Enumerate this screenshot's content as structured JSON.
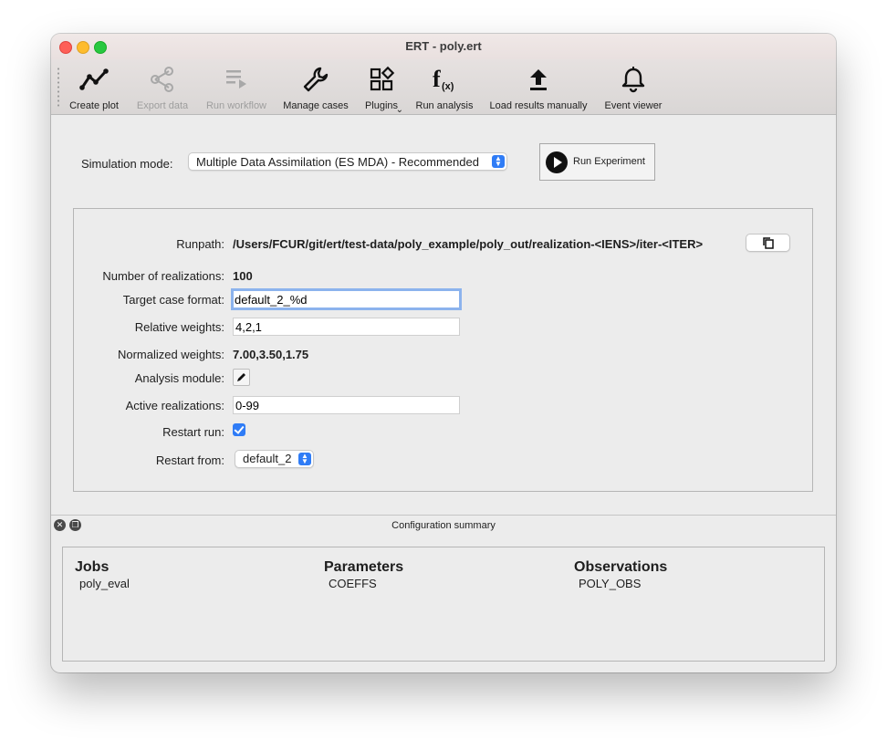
{
  "window": {
    "title": "ERT - poly.ert"
  },
  "toolbar": {
    "create_plot": "Create plot",
    "export_data": "Export data",
    "run_workflow": "Run workflow",
    "manage_cases": "Manage cases",
    "plugins": "Plugins",
    "run_analysis": "Run analysis",
    "load_results": "Load results manually",
    "event_viewer": "Event viewer"
  },
  "simulation": {
    "mode_label": "Simulation mode:",
    "mode_value": "Multiple Data Assimilation (ES MDA) - Recommended",
    "run_button": "Run Experiment"
  },
  "config": {
    "runpath_label": "Runpath:",
    "runpath_value": "/Users/FCUR/git/ert/test-data/poly_example/poly_out/realization-<IENS>/iter-<ITER>",
    "num_realizations_label": "Number of realizations:",
    "num_realizations_value": "100",
    "target_case_label": "Target case format:",
    "target_case_value": "default_2_%d",
    "relative_weights_label": "Relative weights:",
    "relative_weights_value": "4,2,1",
    "normalized_weights_label": "Normalized weights:",
    "normalized_weights_value": "7.00,3.50,1.75",
    "analysis_module_label": "Analysis module:",
    "active_realizations_label": "Active realizations:",
    "active_realizations_value": "0-99",
    "restart_run_label": "Restart run:",
    "restart_run_checked": true,
    "restart_from_label": "Restart from:",
    "restart_from_value": "default_2"
  },
  "summary": {
    "title": "Configuration summary",
    "jobs_header": "Jobs",
    "jobs": [
      "poly_eval"
    ],
    "parameters_header": "Parameters",
    "parameters": [
      "COEFFS"
    ],
    "observations_header": "Observations",
    "observations": [
      "POLY_OBS"
    ]
  },
  "colors": {
    "accent": "#2f7cf6",
    "focus_ring": "#8cb3ed"
  }
}
